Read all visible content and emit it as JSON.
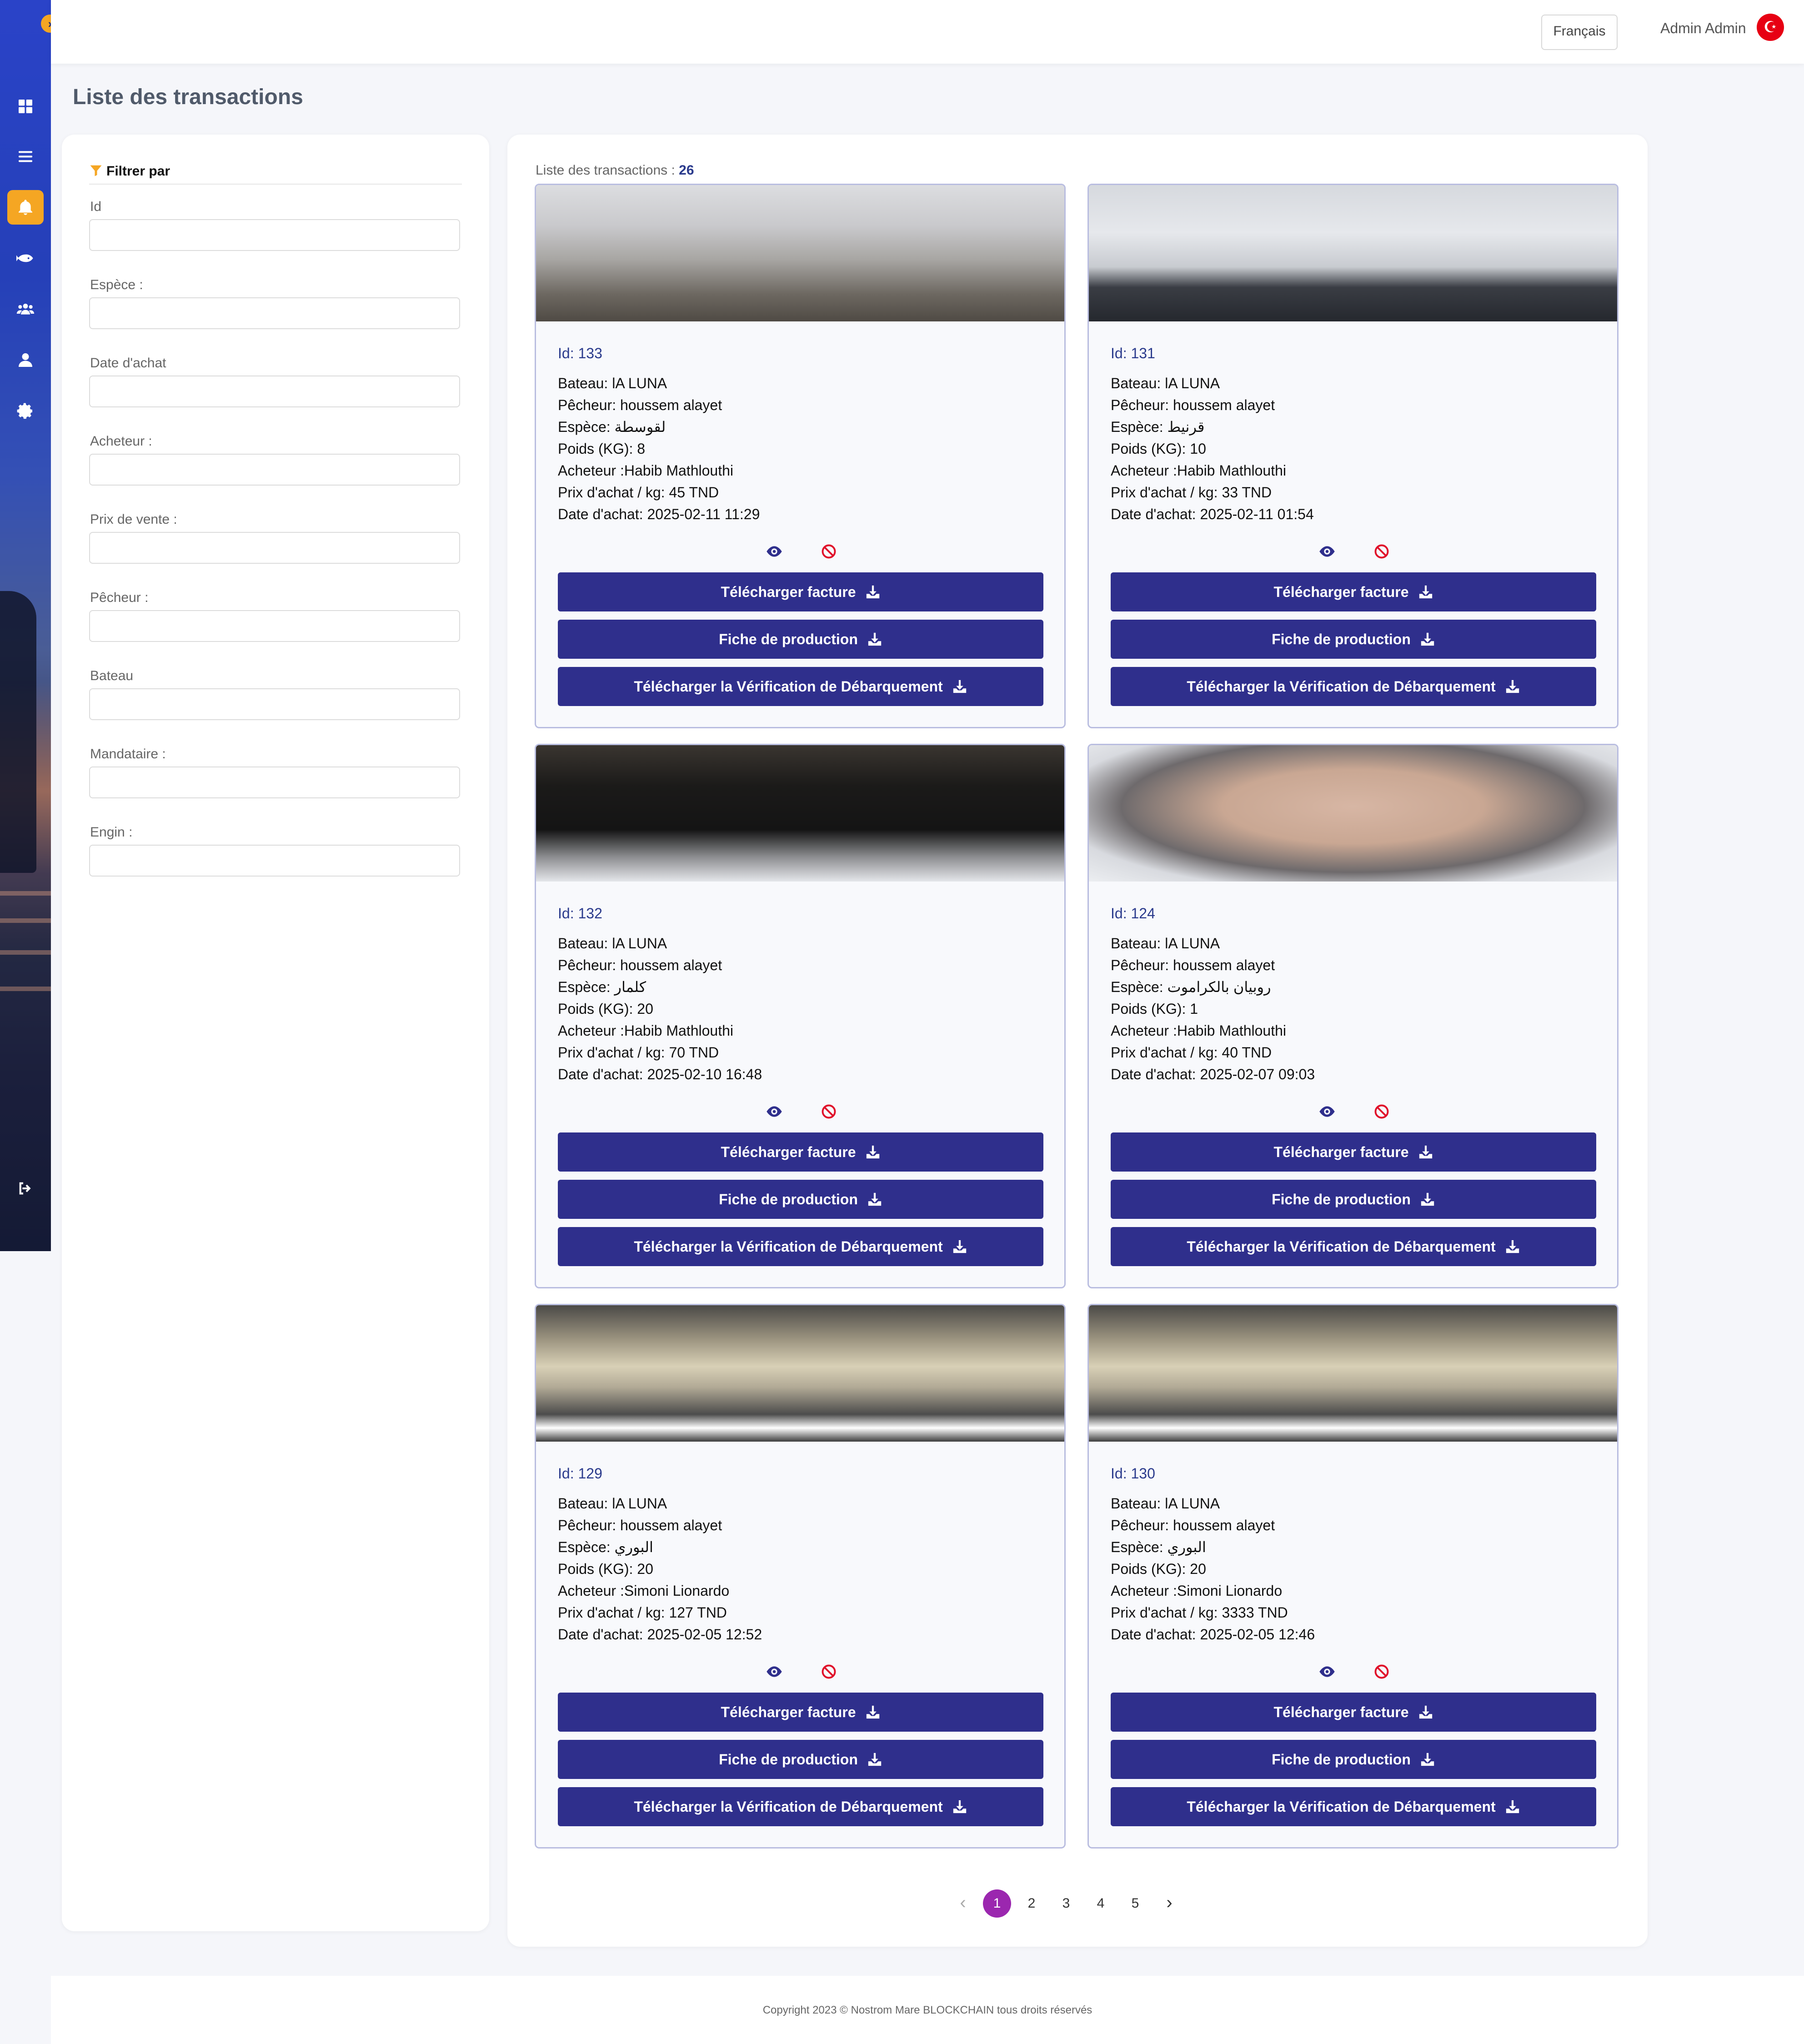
{
  "header": {
    "language": "Français",
    "user_name": "Admin Admin",
    "flag_icon": "tunisia-flag-icon"
  },
  "page_title": "Liste des transactions",
  "filters": {
    "title": "Filtrer par",
    "fields": [
      {
        "label": "Id",
        "value": ""
      },
      {
        "label": "Espèce :",
        "value": ""
      },
      {
        "label": "Date d'achat",
        "value": ""
      },
      {
        "label": "Acheteur :",
        "value": ""
      },
      {
        "label": "Prix de vente :",
        "value": ""
      },
      {
        "label": "Pêcheur :",
        "value": ""
      },
      {
        "label": "Bateau",
        "value": ""
      },
      {
        "label": "Mandataire :",
        "value": ""
      },
      {
        "label": "Engin :",
        "value": ""
      }
    ]
  },
  "list": {
    "count_label": "Liste des transactions :",
    "count": "26",
    "buttons": {
      "invoice": "Télécharger facture",
      "production": "Fiche de production",
      "verification": "Télécharger la Vérification de Débarquement"
    },
    "transactions": [
      {
        "id": "Id: 133",
        "bateau": "Bateau: lA LUNA",
        "pecheur": "Pêcheur: houssem alayet",
        "espece": "Espèce: لقوسطة",
        "poids": "Poids (KG): 8",
        "acheteur": "Acheteur :Habib Mathlouthi",
        "prix": "Prix d'achat / kg: 45 TND",
        "date": "Date d'achat: 2025-02-11 11:29"
      },
      {
        "id": "Id: 131",
        "bateau": "Bateau: lA LUNA",
        "pecheur": "Pêcheur: houssem alayet",
        "espece": "Espèce: قرنيط",
        "poids": "Poids (KG): 10",
        "acheteur": "Acheteur :Habib Mathlouthi",
        "prix": "Prix d'achat / kg: 33 TND",
        "date": "Date d'achat: 2025-02-11 01:54"
      },
      {
        "id": "Id: 132",
        "bateau": "Bateau: lA LUNA",
        "pecheur": "Pêcheur: houssem alayet",
        "espece": "Espèce: كلمار",
        "poids": "Poids (KG): 20",
        "acheteur": "Acheteur :Habib Mathlouthi",
        "prix": "Prix d'achat / kg: 70 TND",
        "date": "Date d'achat: 2025-02-10 16:48"
      },
      {
        "id": "Id: 124",
        "bateau": "Bateau: lA LUNA",
        "pecheur": "Pêcheur: houssem alayet",
        "espece": "Espèce: روبيان بالكراموت",
        "poids": "Poids (KG): 1",
        "acheteur": "Acheteur :Habib Mathlouthi",
        "prix": "Prix d'achat / kg: 40 TND",
        "date": "Date d'achat: 2025-02-07 09:03"
      },
      {
        "id": "Id: 129",
        "bateau": "Bateau: lA LUNA",
        "pecheur": "Pêcheur: houssem alayet",
        "espece": "Espèce: البوري",
        "poids": "Poids (KG): 20",
        "acheteur": "Acheteur :Simoni Lionardo",
        "prix": "Prix d'achat / kg: 127 TND",
        "date": "Date d'achat: 2025-02-05 12:52"
      },
      {
        "id": "Id: 130",
        "bateau": "Bateau: lA LUNA",
        "pecheur": "Pêcheur: houssem alayet",
        "espece": "Espèce: البوري",
        "poids": "Poids (KG): 20",
        "acheteur": "Acheteur :Simoni Lionardo",
        "prix": "Prix d'achat / kg: 3333 TND",
        "date": "Date d'achat: 2025-02-05 12:46"
      }
    ]
  },
  "pagination": {
    "prev": "‹",
    "next": "›",
    "pages": [
      "1",
      "2",
      "3",
      "4",
      "5"
    ],
    "current": "1"
  },
  "footer": {
    "copyright": "Copyright 2023 © Nostrom Mare BLOCKCHAIN  tous droits réservés"
  },
  "colors": {
    "primary_button": "#2f2f8c",
    "accent": "#f5a623",
    "active_page": "#9b27af",
    "id_text": "#2a3a8c"
  }
}
